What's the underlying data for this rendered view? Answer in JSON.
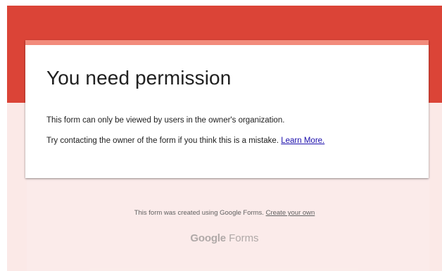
{
  "card": {
    "title": "You need permission",
    "message_1": "This form can only be viewed by users in the owner's organization.",
    "message_2": "Try contacting the owner of the form if you think this is a mistake.",
    "learn_more": "Learn More."
  },
  "footer": {
    "created_text": "This form was created using Google Forms.",
    "create_link": "Create your own",
    "brand_google": "Google",
    "brand_forms": "Forms"
  },
  "colors": {
    "banner": "#db4437",
    "background": "#fbe9e7",
    "card_accent": "#f28b7c",
    "link": "#1a0dab"
  }
}
